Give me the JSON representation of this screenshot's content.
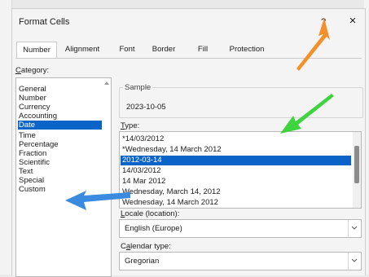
{
  "dialog": {
    "title": "Format Cells",
    "help": "?",
    "close": "×"
  },
  "tabs": [
    "Number",
    "Alignment",
    "Font",
    "Border",
    "Fill",
    "Protection"
  ],
  "category": {
    "label": "Category:",
    "items": [
      "General",
      "Number",
      "Currency",
      "Accounting",
      "Date",
      "Time",
      "Percentage",
      "Fraction",
      "Scientific",
      "Text",
      "Special",
      "Custom"
    ],
    "selected": "Date"
  },
  "sample": {
    "label": "Sample",
    "value": "2023-10-05"
  },
  "type": {
    "label": "Type:",
    "items": [
      "*14/03/2012",
      "*Wednesday, 14 March 2012",
      "2012-03-14",
      "14/03/2012",
      "14 Mar 2012",
      "Wednesday, March 14, 2012",
      "Wednesday, 14 March 2012"
    ],
    "selected": "2012-03-14"
  },
  "locale": {
    "label": "Locale (location):",
    "value": "English (Europe)"
  },
  "calendar": {
    "label": "Calendar type:",
    "value": "Gregorian"
  },
  "annotations": {
    "orange_arrow_color": "#f4902b",
    "green_arrow_color": "#3fd33f",
    "blue_arrow_color": "#3a8be0"
  }
}
